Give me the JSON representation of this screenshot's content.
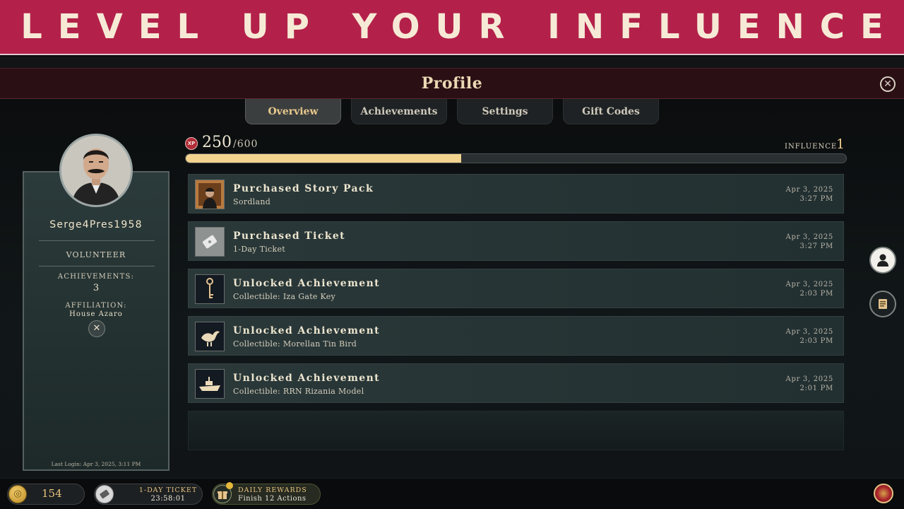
{
  "banner": {
    "text": "LEVEL UP YOUR INFLUENCE"
  },
  "header": {
    "title": "Profile",
    "close_icon": "close-icon"
  },
  "tabs": [
    {
      "label": "Overview",
      "active": true
    },
    {
      "label": "Achievements",
      "active": false
    },
    {
      "label": "Settings",
      "active": false
    },
    {
      "label": "Gift Codes",
      "active": false
    }
  ],
  "profile": {
    "username": "Serge4Pres1958",
    "rank": "VOLUNTEER",
    "achievements_label": "ACHIEVEMENTS:",
    "achievements_count": "3",
    "affiliation_label": "AFFILIATION:",
    "affiliation_value": "House Azaro",
    "last_login": "Last Login: Apr 3, 2025, 3:11 PM"
  },
  "xp": {
    "badge": "XP",
    "current": "250",
    "max": "/600",
    "progress_fraction": 0.4167
  },
  "influence": {
    "label": "INFLUENCE",
    "value": "1"
  },
  "activity": [
    {
      "title": "Purchased Story Pack",
      "subtitle": "Sordland",
      "date": "Apr 3, 2025",
      "time": "3:27 PM",
      "icon": "portrait-thumbnail"
    },
    {
      "title": "Purchased Ticket",
      "subtitle": "1-Day Ticket",
      "date": "Apr 3, 2025",
      "time": "3:27 PM",
      "icon": "ticket-icon"
    },
    {
      "title": "Unlocked Achievement",
      "subtitle": "Collectible: Iza Gate Key",
      "date": "Apr 3, 2025",
      "time": "2:03 PM",
      "icon": "key-icon"
    },
    {
      "title": "Unlocked Achievement",
      "subtitle": "Collectible: Morellan Tin Bird",
      "date": "Apr 3, 2025",
      "time": "2:03 PM",
      "icon": "bird-icon"
    },
    {
      "title": "Unlocked Achievement",
      "subtitle": "Collectible: RRN Rizania Model",
      "date": "Apr 3, 2025",
      "time": "2:01 PM",
      "icon": "ship-icon"
    }
  ],
  "footer": {
    "coins": "154",
    "ticket_label": "1-DAY TICKET",
    "ticket_timer": "23:58:01",
    "daily_label": "DAILY REWARDS",
    "daily_sub": "Finish 12 Actions"
  },
  "colors": {
    "banner": "#b3214a",
    "accent_gold": "#f2d48f",
    "header": "#2a0f14"
  }
}
